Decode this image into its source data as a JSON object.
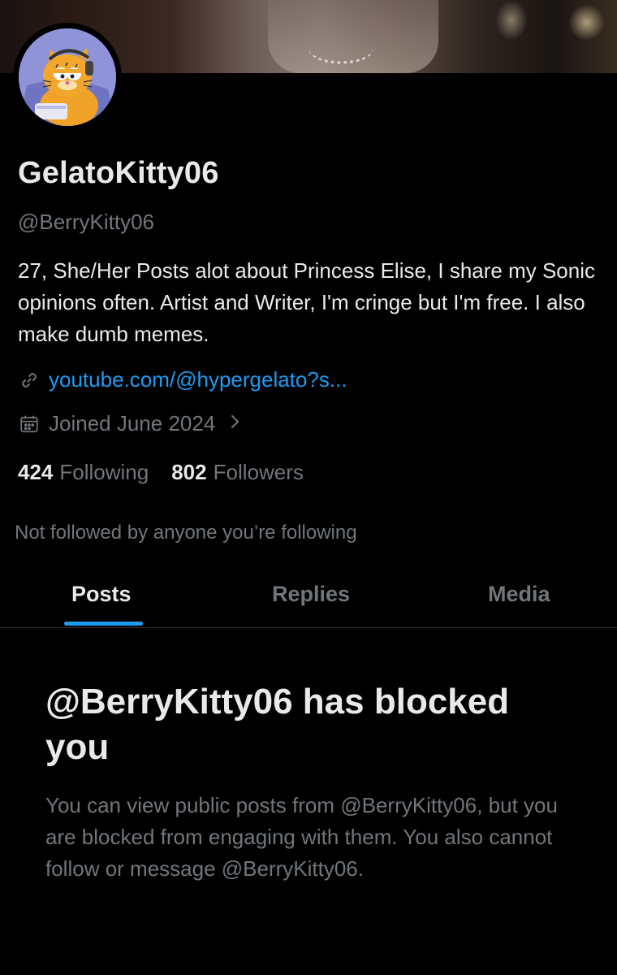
{
  "profile": {
    "display_name": "GelatoKitty06",
    "handle": "@BerryKitty06",
    "bio": "27, She/Her Posts alot about Princess Elise, I share my Sonic opinions often. Artist and Writer, I'm cringe but I'm free. I also make dumb memes.",
    "link": "youtube.com/@hypergelato?s...",
    "joined": "Joined June 2024",
    "following_count": "424",
    "following_label": "Following",
    "followers_count": "802",
    "followers_label": "Followers",
    "not_followed_text": "Not followed by anyone you’re following"
  },
  "icons": {
    "link": "link-icon",
    "calendar": "calendar-icon",
    "chevron": "chevron-right-icon"
  },
  "tabs": [
    {
      "label": "Posts",
      "active": true
    },
    {
      "label": "Replies",
      "active": false
    },
    {
      "label": "Media",
      "active": false
    }
  ],
  "blocked": {
    "title": "@BerryKitty06 has blocked you",
    "description": "You can view public posts from @BerryKitty06, but you are blocked from engaging with them. You also cannot follow or message @BerryKitty06."
  },
  "colors": {
    "background": "#000000",
    "primary_text": "#e7e9ea",
    "secondary_text": "#71767b",
    "accent": "#1d9bf0",
    "divider": "#2f3336"
  }
}
